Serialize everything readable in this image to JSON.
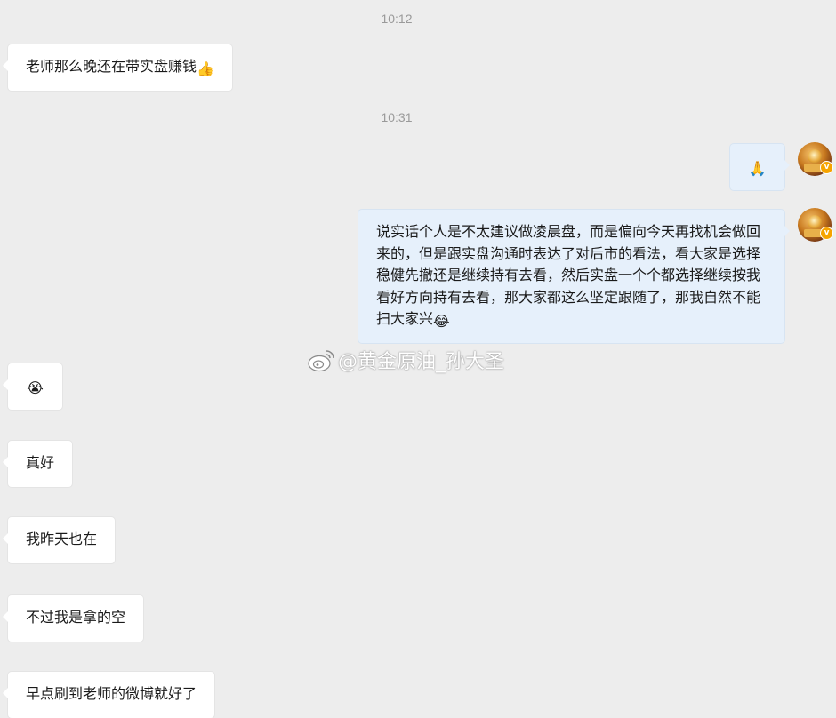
{
  "chat": {
    "timestamps": [
      "10:12",
      "10:31"
    ],
    "messages": [
      {
        "side": "left",
        "text": "老师那么晚还在带实盘赚钱",
        "emoji": "👍"
      },
      {
        "side": "right",
        "text": "",
        "emoji": "🙏"
      },
      {
        "side": "right",
        "text": "说实话个人是不太建议做凌晨盘，而是偏向今天再找机会做回来的，但是跟实盘沟通时表达了对后市的看法，看大家是选择稳健先撤还是继续持有去看，然后实盘一个个都选择继续按我看好方向持有去看，那大家都这么坚定跟随了，那我自然不能扫大家兴",
        "emoji": "😂"
      },
      {
        "side": "left",
        "text": "",
        "emoji": "😭"
      },
      {
        "side": "left",
        "text": "真好",
        "emoji": ""
      },
      {
        "side": "left",
        "text": "我昨天也在",
        "emoji": ""
      },
      {
        "side": "left",
        "text": "不过我是拿的空",
        "emoji": ""
      },
      {
        "side": "left",
        "text": "早点刷到老师的微博就好了",
        "emoji": ""
      }
    ],
    "avatar_badge": "v"
  },
  "watermark": {
    "text": "@黄金原油_孙大圣",
    "icon": "weibo-icon"
  },
  "colors": {
    "background": "#ededed",
    "left_bubble": "#ffffff",
    "right_bubble": "#e6f0fb",
    "timestamp": "#9a9a9a",
    "badge": "#f6a400"
  }
}
